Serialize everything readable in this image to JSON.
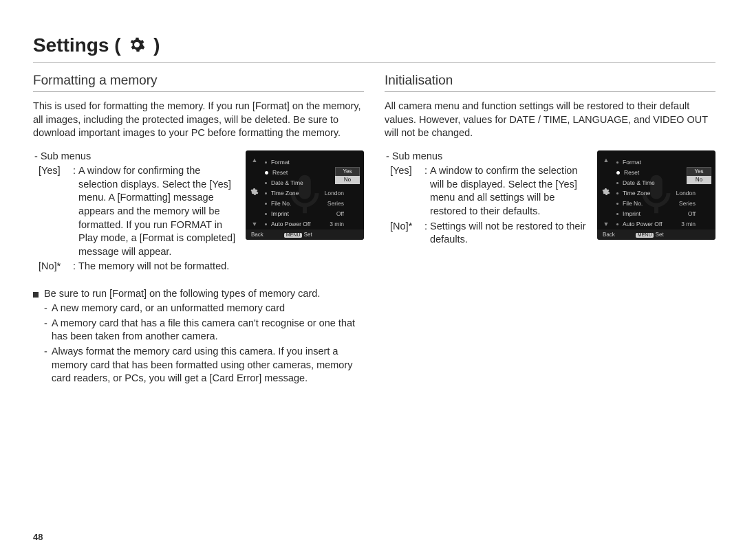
{
  "page_number": "48",
  "title": "Settings",
  "title_paren_open": " ( ",
  "title_paren_close": " )",
  "left": {
    "heading": "Formatting a memory",
    "intro": "This is used for formatting the memory. If you run [Format] on the memory, all images, including the protected images, will be deleted. Be sure to download important images to your PC before formatting the memory.",
    "sub_label": "- Sub menus",
    "options": [
      {
        "key": "[Yes]",
        "desc": "A window for confirming the selection displays. Select the [Yes] menu. A [Formatting] message appears and the memory will be formatted. If you run FORMAT in Play mode, a [Format is completed] message will appear."
      },
      {
        "key": "[No]*",
        "desc": "The memory will not be formatted."
      }
    ],
    "notes_lead": "Be sure to run [Format] on the following types of memory card.",
    "notes": [
      "A new memory card, or an unformatted memory card",
      "A memory card that has a file this camera can't recognise or one that has been taken from another camera.",
      "Always format the memory card using this camera. If you insert a memory card that has been formatted using other cameras, memory card readers, or PCs, you will get a [Card Error] message."
    ]
  },
  "right": {
    "heading": "Initialisation",
    "intro": "All camera menu and function settings will be restored to their default values. However, values for DATE / TIME, LANGUAGE, and VIDEO OUT will not be changed.",
    "sub_label": "- Sub menus",
    "options": [
      {
        "key": "[Yes]",
        "desc": "A window to confirm the selection will be displayed. Select the [Yes] menu and all settings will be restored to their defaults."
      },
      {
        "key": "[No]*",
        "desc": "Settings will not be restored to their defaults."
      }
    ]
  },
  "shot": {
    "menu": [
      {
        "label": "Format",
        "value": "",
        "selected": false
      },
      {
        "label": "Reset",
        "value": "",
        "selected": true
      },
      {
        "label": "Date & Time",
        "value": "",
        "selected": false
      },
      {
        "label": "Time Zone",
        "value": "London",
        "selected": false
      },
      {
        "label": "File No.",
        "value": "Series",
        "selected": false
      },
      {
        "label": "Imprint",
        "value": "Off",
        "selected": false
      },
      {
        "label": "Auto Power Off",
        "value": "3 min",
        "selected": false
      }
    ],
    "popup": {
      "yes": "Yes",
      "no": "No"
    },
    "bar": {
      "back": "Back",
      "set": "Set",
      "set_btn": "MENU"
    }
  }
}
